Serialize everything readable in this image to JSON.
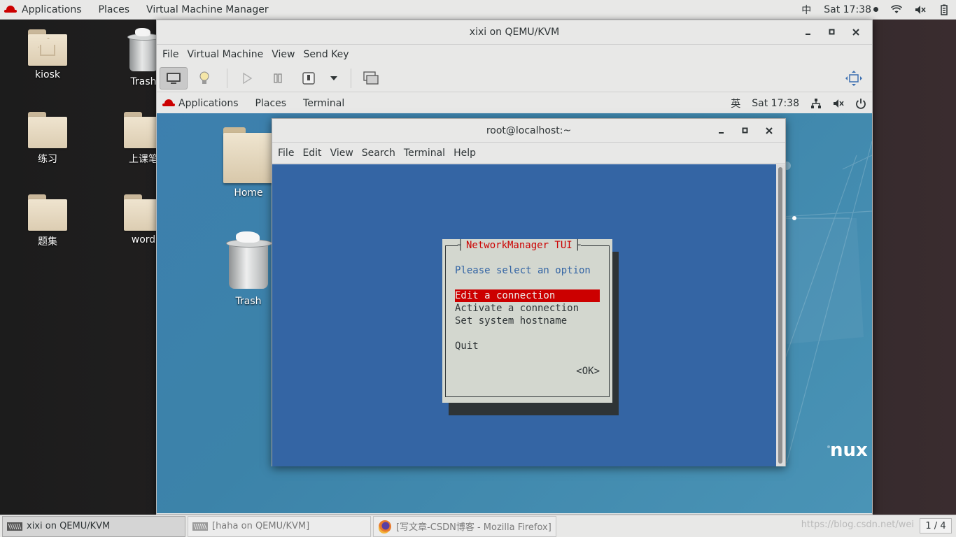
{
  "host_topbar": {
    "applications": "Applications",
    "places": "Places",
    "app_menu": "Virtual Machine Manager",
    "input_method": "中",
    "clock": "Sat 17:38"
  },
  "host_desktop": {
    "icons": [
      {
        "label": "kiosk"
      },
      {
        "label": "Trash"
      },
      {
        "label": "练习"
      },
      {
        "label": "上课笔"
      },
      {
        "label": "题集"
      },
      {
        "label": "word"
      }
    ]
  },
  "vm_window": {
    "title": "xixi on QEMU/KVM",
    "menu": [
      "File",
      "Virtual Machine",
      "View",
      "Send Key"
    ],
    "toolbar_icons": [
      "console-icon",
      "details-bulb-icon",
      "run-icon",
      "pause-icon",
      "shutdown-icon",
      "dropdown-arrow-icon",
      "snapshots-icon",
      "fullscreen-icon"
    ]
  },
  "guest": {
    "topbar": {
      "applications": "Applications",
      "places": "Places",
      "app_menu": "Terminal",
      "input_method": "英",
      "clock": "Sat 17:38"
    },
    "desktop_icons": [
      {
        "label": "Home"
      },
      {
        "label": "Trash"
      }
    ],
    "brand_fragment": "nux"
  },
  "terminal": {
    "title": "root@localhost:~",
    "menu": [
      "File",
      "Edit",
      "View",
      "Search",
      "Terminal",
      "Help"
    ]
  },
  "nmtui": {
    "title": "NetworkManager TUI",
    "prompt": "Please select an option",
    "options": [
      "Edit a connection",
      "Activate a connection",
      "Set system hostname"
    ],
    "selected_index": 0,
    "quit": "Quit",
    "ok": "<OK>"
  },
  "taskbar": {
    "tasks": [
      {
        "label": "xixi on QEMU/KVM"
      },
      {
        "label": "[haha on QEMU/KVM]"
      },
      {
        "label": "[写文章-CSDN博客 - Mozilla Firefox]"
      }
    ],
    "watermark": "https://blog.csdn.net/wei",
    "workspace": "1 / 4"
  },
  "colors": {
    "terminal_bg": "#3465a4",
    "dialog_bg": "#d3d7cf",
    "accent_red": "#cc0000"
  }
}
